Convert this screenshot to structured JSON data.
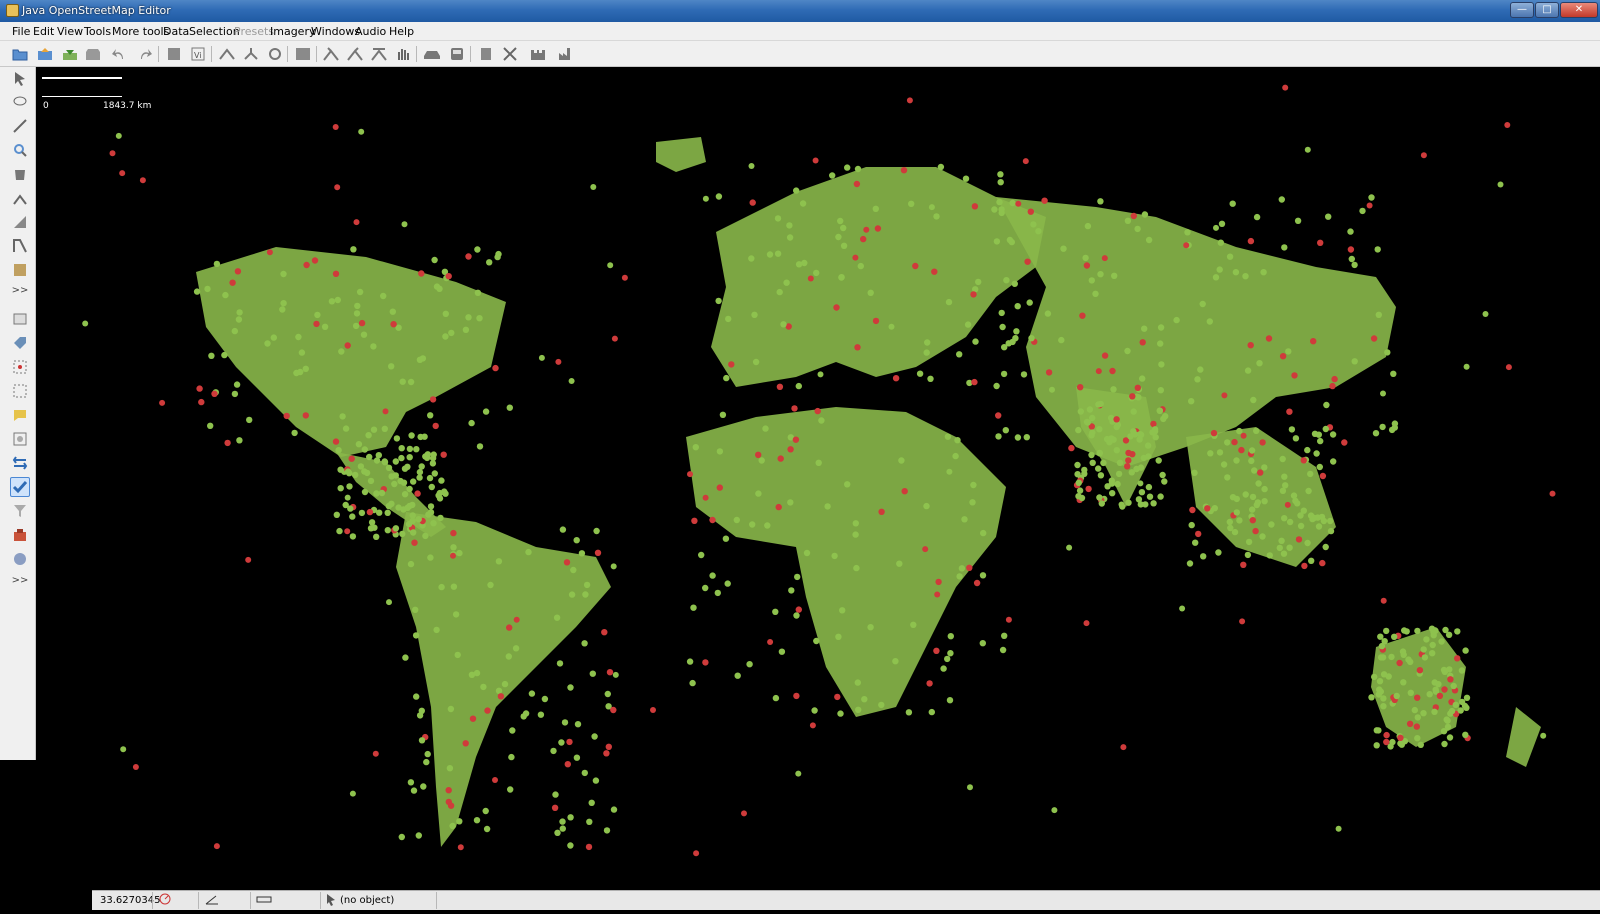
{
  "window": {
    "title": "Java OpenStreetMap Editor",
    "buttons": {
      "minimize": "—",
      "maximize": "□",
      "close": "✕"
    }
  },
  "menubar": [
    "File",
    "Edit",
    "View",
    "Tools",
    "More tools",
    "Data",
    "Selection",
    "Presets",
    "Imagery",
    "Windows",
    "Audio",
    "Help"
  ],
  "menubar_disabled": [
    "Presets"
  ],
  "toolbar": {
    "icons": [
      "open-icon",
      "upload-icon",
      "download-icon",
      "save-icon",
      "undo-icon",
      "redo-icon",
      "preferences-icon",
      "download-area-icon",
      "split-way-icon",
      "combine-icon",
      "refresh-icon",
      "align-icon",
      "merge-nodes-icon",
      "unglue-icon",
      "shortcut-icon",
      "hand-icon",
      "car-icon",
      "bus-icon",
      "barrier-icon",
      "cross-icon",
      "castle-icon",
      "factory-icon"
    ]
  },
  "leftbar": {
    "more_label": ">>",
    "more_label_2": ">>"
  },
  "map": {
    "background": "#000000",
    "land_color": "#8ab84a",
    "marker_green": "#8ec24e",
    "marker_red": "#cf3b3b",
    "scale": {
      "zero": "0",
      "distance": "1843.7 km"
    }
  },
  "statusbar": {
    "coordinate": "33.6270345",
    "object": "(no object)"
  }
}
